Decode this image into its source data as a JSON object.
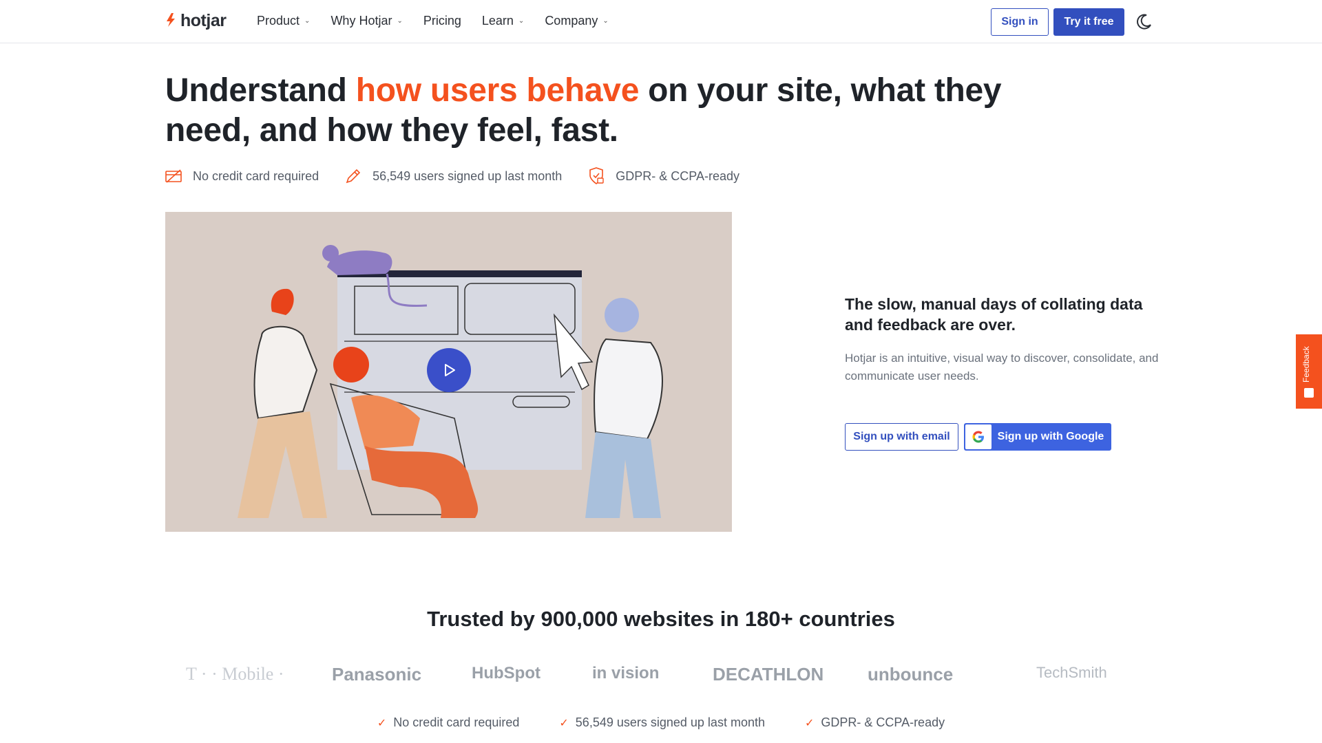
{
  "header": {
    "logo_text": "hotjar",
    "nav": [
      {
        "label": "Product",
        "has_dropdown": true
      },
      {
        "label": "Why Hotjar",
        "has_dropdown": true
      },
      {
        "label": "Pricing",
        "has_dropdown": false
      },
      {
        "label": "Learn",
        "has_dropdown": true
      },
      {
        "label": "Company",
        "has_dropdown": true
      }
    ],
    "signin_label": "Sign in",
    "try_label": "Try it free",
    "theme_icon": "moon-icon"
  },
  "hero": {
    "headline_pre": "Understand ",
    "headline_accent": "how users behave",
    "headline_post": " on your site, what they need, and how they feel, fast.",
    "badges": [
      {
        "icon": "credit-card-off-icon",
        "text": "No credit card required"
      },
      {
        "icon": "pencil-icon",
        "text": "56,549 users signed up last month"
      },
      {
        "icon": "shield-lock-icon",
        "text": "GDPR- & CCPA-ready"
      }
    ],
    "side_title": "The slow, manual days of collating data and feedback are over.",
    "side_desc": "Hotjar is an intuitive, visual way to discover, consolidate, and communicate user needs.",
    "signup_email_label": "Sign up with email",
    "signup_google_label": "Sign up with Google"
  },
  "feedback_tab": {
    "label": "Feedback"
  },
  "trusted": {
    "title": "Trusted by 900,000 websites in 180+ countries",
    "logos": [
      "T · · Mobile ·",
      "Panasonic",
      "HubSpot",
      "in vision",
      "DECATHLON",
      "unbounce",
      "TechSmith"
    ]
  },
  "bottom_checks": [
    "No credit card required",
    "56,549 users signed up last month",
    "GDPR- & CCPA-ready"
  ],
  "colors": {
    "accent": "#f4511e",
    "primary": "#324fbe",
    "google_button": "#3d63e0",
    "video_bg": "#d9cdc6"
  }
}
